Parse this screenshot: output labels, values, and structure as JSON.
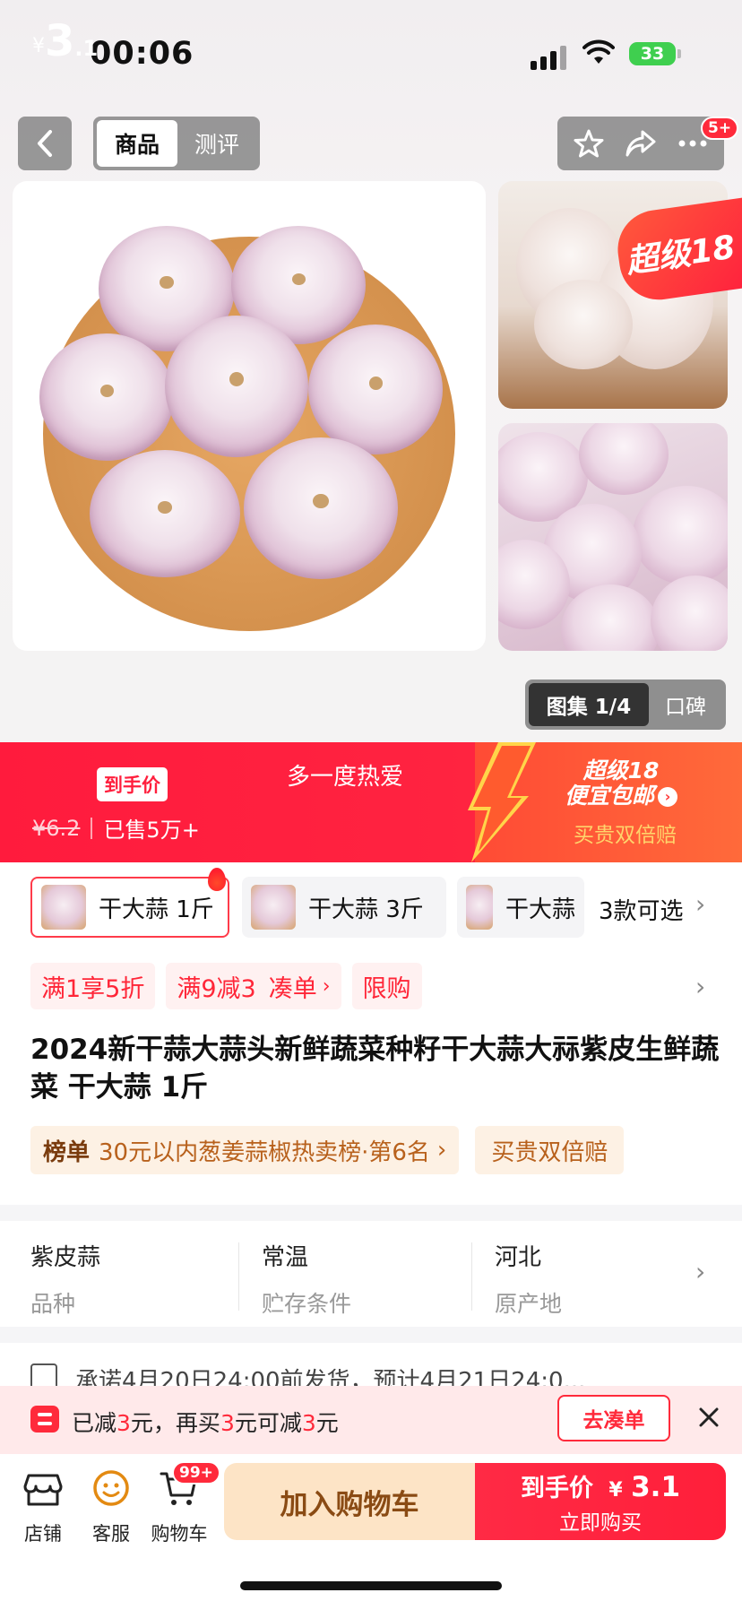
{
  "status_bar": {
    "time": "00:06",
    "battery": "33"
  },
  "nav": {
    "tab_product": "商品",
    "tab_review": "测评",
    "badge": "5+"
  },
  "hero": {
    "badge_text": "超级18",
    "gallery_label": "图集 1/4",
    "word_of_mouth": "口碑"
  },
  "price": {
    "currency": "¥",
    "integer": "3",
    "decimal": ".1",
    "final_tag": "到手价",
    "original": "¥6.2",
    "sold": "已售5万+",
    "slogan": "多一度热爱",
    "promo_title_1": "超级18",
    "promo_title_2": "便宜包邮",
    "promo_sub": "买贵双倍赔"
  },
  "variants": {
    "items": [
      {
        "label": "干大蒜 1斤"
      },
      {
        "label": "干大蒜 3斤"
      },
      {
        "label": "干大蒜"
      }
    ],
    "more": "3款可选"
  },
  "coupons": [
    "满1享5折",
    "满9减3",
    "凑单",
    "限购"
  ],
  "product": {
    "title": "2024新干蒜大蒜头新鲜蔬菜种籽干大蒜大祘紫皮生鲜蔬菜 干大蒜 1斤",
    "rank_label": "榜单",
    "rank_text": "30元以内葱姜蒜椒热卖榜·第6名",
    "guarantee": "买贵双倍赔"
  },
  "specs": [
    {
      "value": "紫皮蒜",
      "key": "品种"
    },
    {
      "value": "常温",
      "key": "贮存条件"
    },
    {
      "value": "河北",
      "key": "原产地"
    }
  ],
  "shipping": "承诺4月20日24:00前发货，预计4月21日24:0...",
  "discount": {
    "t1": "已减",
    "n1": "3",
    "t2": "元，再买",
    "n2": "3",
    "t3": "元可减",
    "n3": "3",
    "t4": "元",
    "button": "去凑单"
  },
  "bottom_bar": {
    "store": "店铺",
    "service": "客服",
    "cart": "购物车",
    "cart_badge": "99+",
    "add_cart": "加入购物车",
    "buy_label": "到手价",
    "buy_currency": "¥",
    "buy_price": "3.1",
    "buy_now": "立即购买"
  },
  "colors": {
    "accent": "#ff2a3b",
    "cart_button": "#fde4c6",
    "coupon_bg": "#fff1f1"
  }
}
